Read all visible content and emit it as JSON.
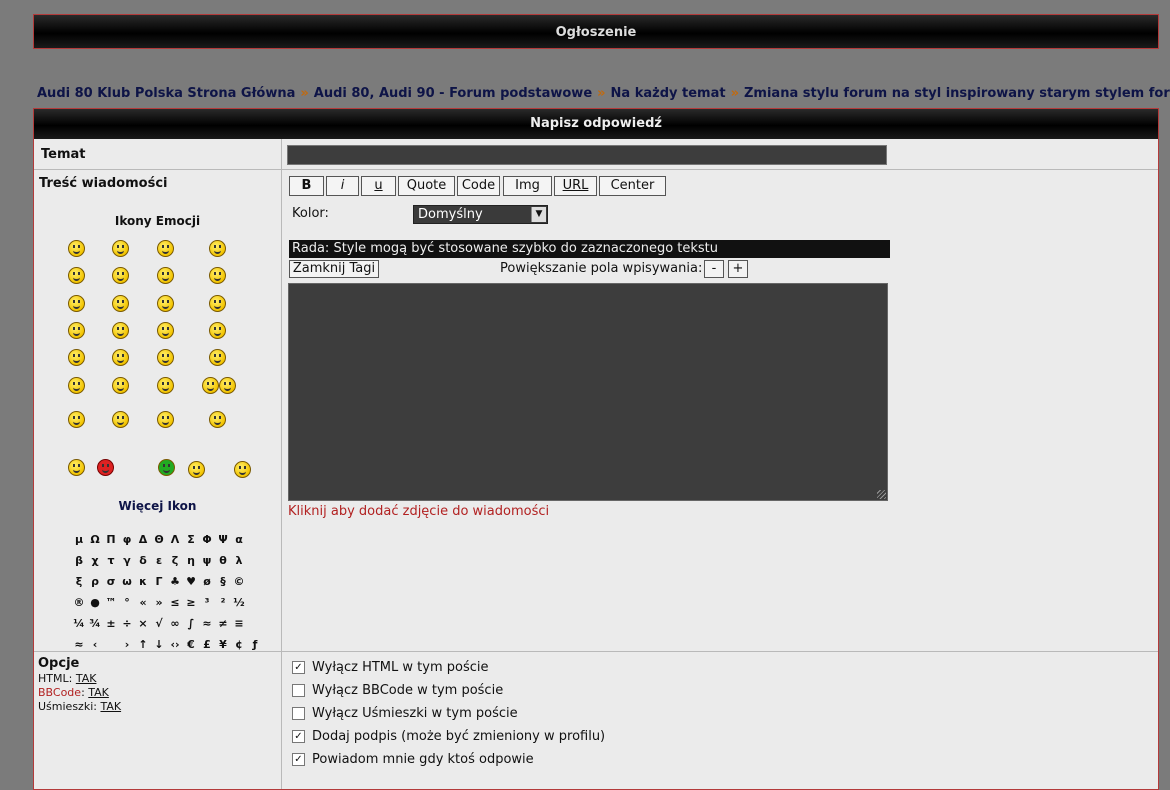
{
  "top_bar": {
    "title": "Ogłoszenie"
  },
  "breadcrumb": {
    "items": [
      "Audi 80 Klub Polska Strona Główna",
      "Audi 80, Audi 90 - Forum podstawowe",
      "Na każdy temat",
      "Zmiana stylu forum na styl inspirowany starym stylem forum"
    ],
    "separator": "»"
  },
  "form": {
    "title": "Napisz odpowiedź",
    "subject_label": "Temat",
    "message_label": "Treść wiadomości",
    "emoticons_title": "Ikony Emocji",
    "more_icons": "Więcej Ikon",
    "toolbar": {
      "bold": "B",
      "italic": "i",
      "underline": "u",
      "quote": "Quote",
      "code": "Code",
      "img": "Img",
      "url": "URL",
      "center": "Center"
    },
    "color_label": "Kolor:",
    "color_value": "Domyślny",
    "hint": "Rada: Style mogą być stosowane szybko do zaznaczonego tekstu",
    "close_tags": "Zamknij Tagi",
    "enlarge_label": "Powiększanie pola wpisywania:",
    "minus": "-",
    "plus": "+",
    "add_photo": "Kliknij aby dodać zdjęcie do wiadomości"
  },
  "symbols": [
    [
      "μ",
      "Ω",
      "Π",
      "φ",
      "Δ",
      "Θ",
      "Λ",
      "Σ",
      "Φ",
      "Ψ",
      "α"
    ],
    [
      "β",
      "χ",
      "τ",
      "γ",
      "δ",
      "ε",
      "ζ",
      "η",
      "ψ",
      "θ",
      "λ"
    ],
    [
      "ξ",
      "ρ",
      "σ",
      "ω",
      "κ",
      "Γ",
      "♣",
      "♥",
      "ø",
      "§",
      "©"
    ],
    [
      "®",
      "●",
      "™",
      "°",
      "«",
      "»",
      "≤",
      "≥",
      "³",
      "²",
      "½"
    ],
    [
      "¼",
      "¾",
      "±",
      "÷",
      "×",
      "√",
      "∞",
      "∫",
      "≈",
      "≠",
      "≡"
    ],
    [
      "≈",
      "‹",
      "",
      "›",
      "↑",
      "↓",
      "‹›",
      "€",
      "£",
      "¥",
      "¢",
      "ƒ"
    ]
  ],
  "options": {
    "title": "Opcje",
    "html_label": "HTML:",
    "html_value": "TAK",
    "bbcode_label": "BBCode",
    "bbcode_value": "TAK",
    "smilies_label": "Uśmieszki:",
    "smilies_value": "TAK",
    "checkboxes": [
      {
        "label": "Wyłącz HTML w tym poście",
        "checked": true
      },
      {
        "label": "Wyłącz BBCode w tym poście",
        "checked": false
      },
      {
        "label": "Wyłącz Uśmieszki w tym poście",
        "checked": false
      },
      {
        "label": "Dodaj podpis (może być zmieniony w profilu)",
        "checked": true
      },
      {
        "label": "Powiadom mnie gdy ktoś odpowie",
        "checked": true
      }
    ]
  },
  "colors": {
    "border_accent": "#b33a3a",
    "breadcrumb_text": "#0e1447",
    "separator": "#c06a10",
    "link_red": "#b22222"
  }
}
